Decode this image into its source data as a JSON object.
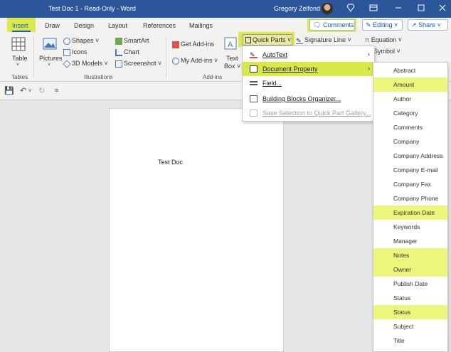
{
  "titlebar": {
    "title": "Test Doc 1  -  Read-Only  -  Word",
    "user": "Gregory Zelfond"
  },
  "tabs": [
    "Insert",
    "Draw",
    "Design",
    "Layout",
    "References",
    "Mailings"
  ],
  "header_buttons": {
    "comments": "Comments",
    "editing": "Editing",
    "share": "Share"
  },
  "ribbon": {
    "table": "Table",
    "pictures": "Pictures",
    "shapes": "Shapes",
    "icons": "Icons",
    "models3d": "3D Models",
    "smartart": "SmartArt",
    "chart": "Chart",
    "screenshot": "Screenshot",
    "get_addins": "Get Add-ins",
    "my_addins": "My Add-ins",
    "text": "Text",
    "box": "Box",
    "quick_parts": "Quick Parts",
    "signature_line": "Signature Line",
    "equation": "Equation",
    "symbol": "Symbol",
    "groups": {
      "tables": "Tables",
      "illustrations": "Illustrations",
      "addins": "Add-ins"
    }
  },
  "document": {
    "text": "Test Doc"
  },
  "quick_parts_menu": [
    {
      "label": "AutoText",
      "submenu": true,
      "enabled": true,
      "selected": false
    },
    {
      "label": "Document Property",
      "submenu": true,
      "enabled": true,
      "selected": true
    },
    {
      "label": "Field...",
      "submenu": false,
      "enabled": true,
      "selected": false
    },
    {
      "label": "Building Blocks Organizer...",
      "submenu": false,
      "enabled": true,
      "selected": false
    },
    {
      "label": "Save Selection to Quick Part Gallery...",
      "submenu": false,
      "enabled": false,
      "selected": false
    }
  ],
  "document_property_menu": [
    {
      "label": "Abstract",
      "highlighted": false
    },
    {
      "label": "Amount",
      "highlighted": true
    },
    {
      "label": "Author",
      "highlighted": false
    },
    {
      "label": "Category",
      "highlighted": false
    },
    {
      "label": "Comments",
      "highlighted": false
    },
    {
      "label": "Company",
      "highlighted": false
    },
    {
      "label": "Company Address",
      "highlighted": false
    },
    {
      "label": "Company E-mail",
      "highlighted": false
    },
    {
      "label": "Company Fax",
      "highlighted": false
    },
    {
      "label": "Company Phone",
      "highlighted": false
    },
    {
      "label": "Expiration Date",
      "highlighted": true
    },
    {
      "label": "Keywords",
      "highlighted": false
    },
    {
      "label": "Manager",
      "highlighted": false
    },
    {
      "label": "Notes",
      "highlighted": true
    },
    {
      "label": "Owner",
      "highlighted": true
    },
    {
      "label": "Publish Date",
      "highlighted": false
    },
    {
      "label": "Status",
      "highlighted": false
    },
    {
      "label": "Status",
      "highlighted": true
    },
    {
      "label": "Subject",
      "highlighted": false
    },
    {
      "label": "Title",
      "highlighted": false
    }
  ],
  "colors": {
    "word_blue": "#2b579a",
    "highlight": "#dbe94c"
  }
}
